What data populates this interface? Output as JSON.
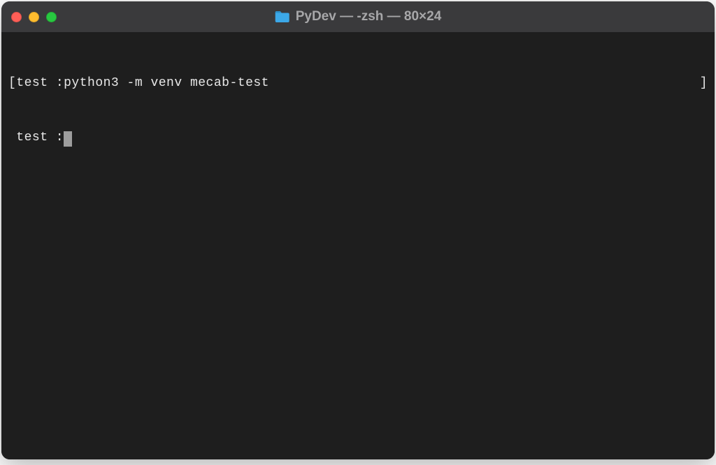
{
  "window": {
    "title": "PyDev — -zsh — 80×24"
  },
  "terminal": {
    "line1_open": "[",
    "line1_prompt": "test :",
    "line1_command": "python3 -m venv mecab-test",
    "line1_close": "]",
    "line2_prompt": " test :"
  }
}
